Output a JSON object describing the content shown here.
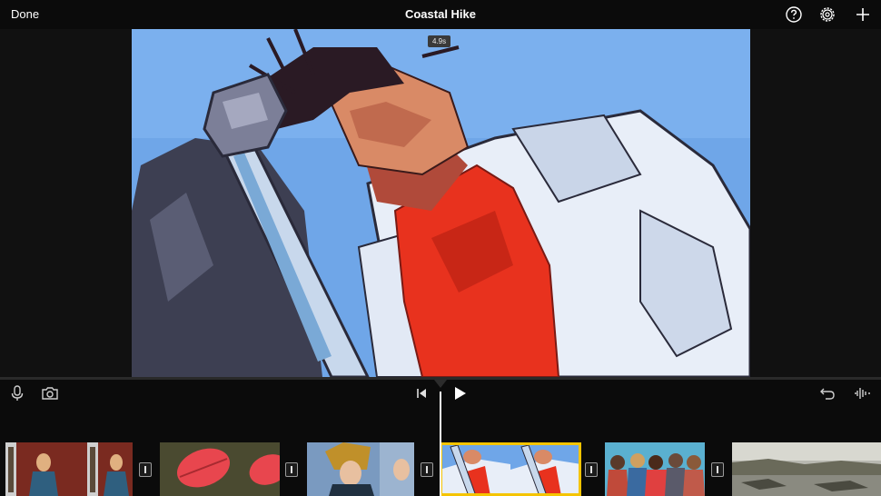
{
  "header": {
    "done_label": "Done",
    "title": "Coastal Hike"
  },
  "viewer": {
    "duration_label": "4.9s"
  },
  "icons": {
    "help": "help-icon",
    "settings": "gear-icon",
    "add": "plus-icon",
    "microphone": "microphone-icon",
    "camera": "camera-icon",
    "skip_back": "skip-to-start-icon",
    "play": "play-icon",
    "undo": "undo-icon",
    "audio": "audio-waveform-icon"
  },
  "colors": {
    "selection": "#f5c400",
    "background": "#0b0b0b"
  },
  "timeline": {
    "clips": [
      "clip-woman-red-doorway",
      "clip-red-leaves",
      "clip-woman-rock",
      "clip-selected-cartoon-jacket",
      "clip-group-friends",
      "clip-beach-rocks"
    ],
    "selected_clip_index": 3
  }
}
